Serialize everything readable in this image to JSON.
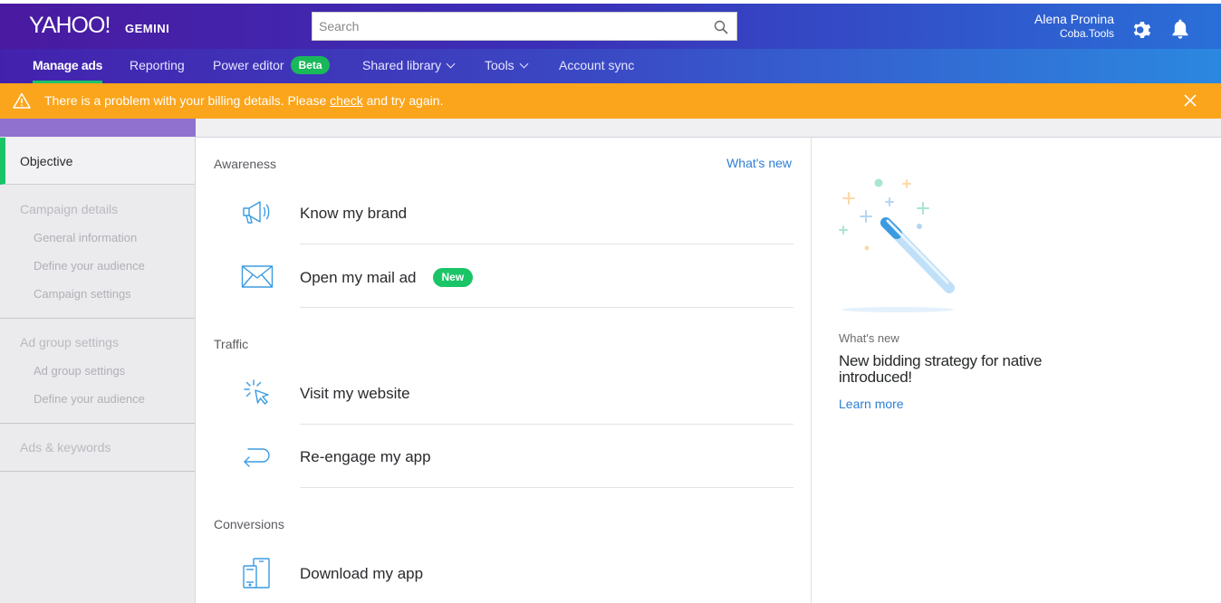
{
  "header": {
    "logo": "YAHOO!",
    "product": "GEMINI",
    "search_placeholder": "Search",
    "user_name": "Alena Pronina",
    "user_org": "Coba.Tools"
  },
  "nav": {
    "manage_ads": "Manage ads",
    "reporting": "Reporting",
    "power_editor": "Power editor",
    "beta": "Beta",
    "shared_library": "Shared library",
    "tools": "Tools",
    "account_sync": "Account sync"
  },
  "alert": {
    "text_before": "There is a problem with your billing details. Please ",
    "link": "check",
    "text_after": " and try again."
  },
  "sidebar": {
    "objective": "Objective",
    "campaign_details": "Campaign details",
    "general_information": "General information",
    "define_audience": "Define your audience",
    "campaign_settings": "Campaign settings",
    "ad_group_settings": "Ad group settings",
    "ad_group_settings_sub": "Ad group settings",
    "define_audience_2": "Define your audience",
    "ads_keywords": "Ads & keywords"
  },
  "main": {
    "awareness": "Awareness",
    "whats_new_link": "What's new",
    "know_brand": "Know my brand",
    "open_mail": "Open my mail ad",
    "new_badge": "New",
    "traffic": "Traffic",
    "visit_website": "Visit my website",
    "reengage_app": "Re-engage my app",
    "conversions": "Conversions",
    "download_app": "Download my app"
  },
  "whats_new": {
    "label": "What's new",
    "title": "New bidding strategy for native introduced!",
    "learn_more": "Learn more"
  },
  "colors": {
    "accent_green": "#1ac567",
    "alert_orange": "#fba51c",
    "link_blue": "#2e7fd4",
    "header_purple": "#4a1aa0"
  }
}
